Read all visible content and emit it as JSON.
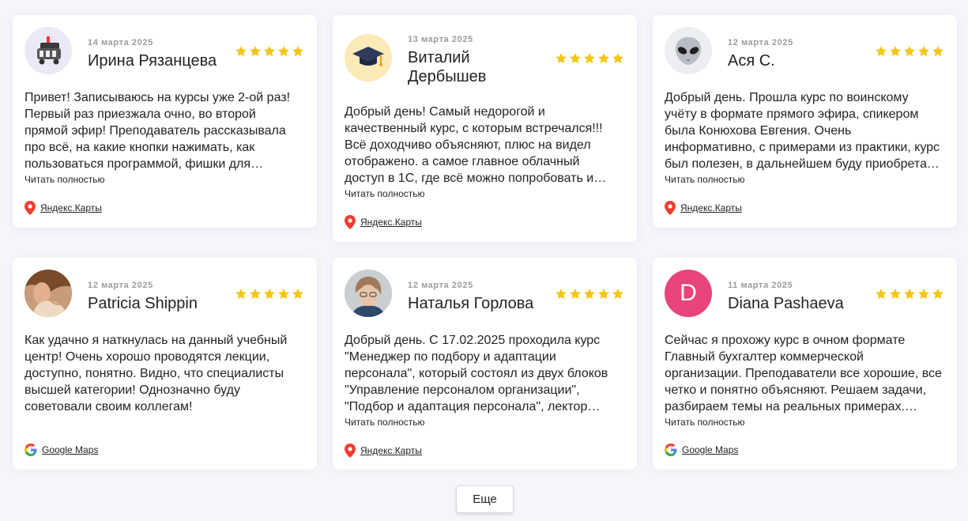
{
  "rating_color": "#f5c518",
  "reviews": [
    {
      "date": "14 марта 2025",
      "name": "Ирина Рязанцева",
      "rating": 5,
      "text": "Привет! Записываюсь на курсы уже 2-ой раз! Первый раз приезжала очно, во второй прямой эфир! Преподаватель рассказывала про всё, на какие кнопки нажимать, как пользоваться программой, фишки для удобства в работе, и многое другое.",
      "read_more": "Читать полностью",
      "source": "Яндекс.Карты",
      "avatar_icon": "robot-avatar-icon"
    },
    {
      "date": "13 марта 2025",
      "name": "Виталий Дербышев",
      "rating": 5,
      "text": "Добрый день! Самый недорогой и качественный курс, с которым встречался!!! Всё доходчиво объясняют, плюс на видел отображено. а самое главное облачный доступ в 1С, где всё можно попробовать и отработать на практике.",
      "read_more": "Читать полностью",
      "source": "Яндекс.Карты",
      "avatar_icon": "graduation-cap-icon"
    },
    {
      "date": "12 марта 2025",
      "name": "Ася С.",
      "rating": 5,
      "text": "Добрый день. Прошла курс по воинскому учёту в формате прямого эфира, спикером была Конюхова Евгения. Очень информативно, с примерами из практики, курс был полезен, в дальнейшем буду приобретать другие курсы и рекомендовать.",
      "read_more": "Читать полностью",
      "source": "Яндекс.Карты",
      "avatar_icon": "alien-icon"
    },
    {
      "date": "12 марта 2025",
      "name": "Patricia Shippin",
      "rating": 5,
      "text": "Как удачно я наткнулась на данный учебный центр! Очень хорошо проводятся лекции, доступно, понятно. Видно, что специалисты высшей категории! Однозначно буду советовали своим коллегам!",
      "source": "Google Maps",
      "avatar_icon": "user-photo-avatar"
    },
    {
      "date": "12 марта 2025",
      "name": "Наталья Горлова",
      "rating": 5,
      "text": "Добрый день. С 17.02.2025 проходила курс \"Менеджер по подбору и адаптации персонала\", который состоял из двух блоков \"Управление персоналом организации\", \"Подбор и адаптация персонала\", лектор Евгения, всё понравилось.",
      "read_more": "Читать полностью",
      "source": "Яндекс.Карты",
      "avatar_icon": "user-photo-avatar"
    },
    {
      "date": "11 марта 2025",
      "name": "Diana Pashaeva",
      "rating": 5,
      "text": "Сейчас я прохожу курс в очном формате Главный бухгалтер коммерческой организации. Преподаватели все хорошие, все четко и понятно объясняют. Решаем задачи, разбираем темы на реальных примерах. Очень довольна.",
      "read_more": "Читать полностью",
      "source": "Google Maps",
      "avatar_letter": "D",
      "avatar_color": "#e8437b"
    }
  ],
  "more_button": "Еще"
}
